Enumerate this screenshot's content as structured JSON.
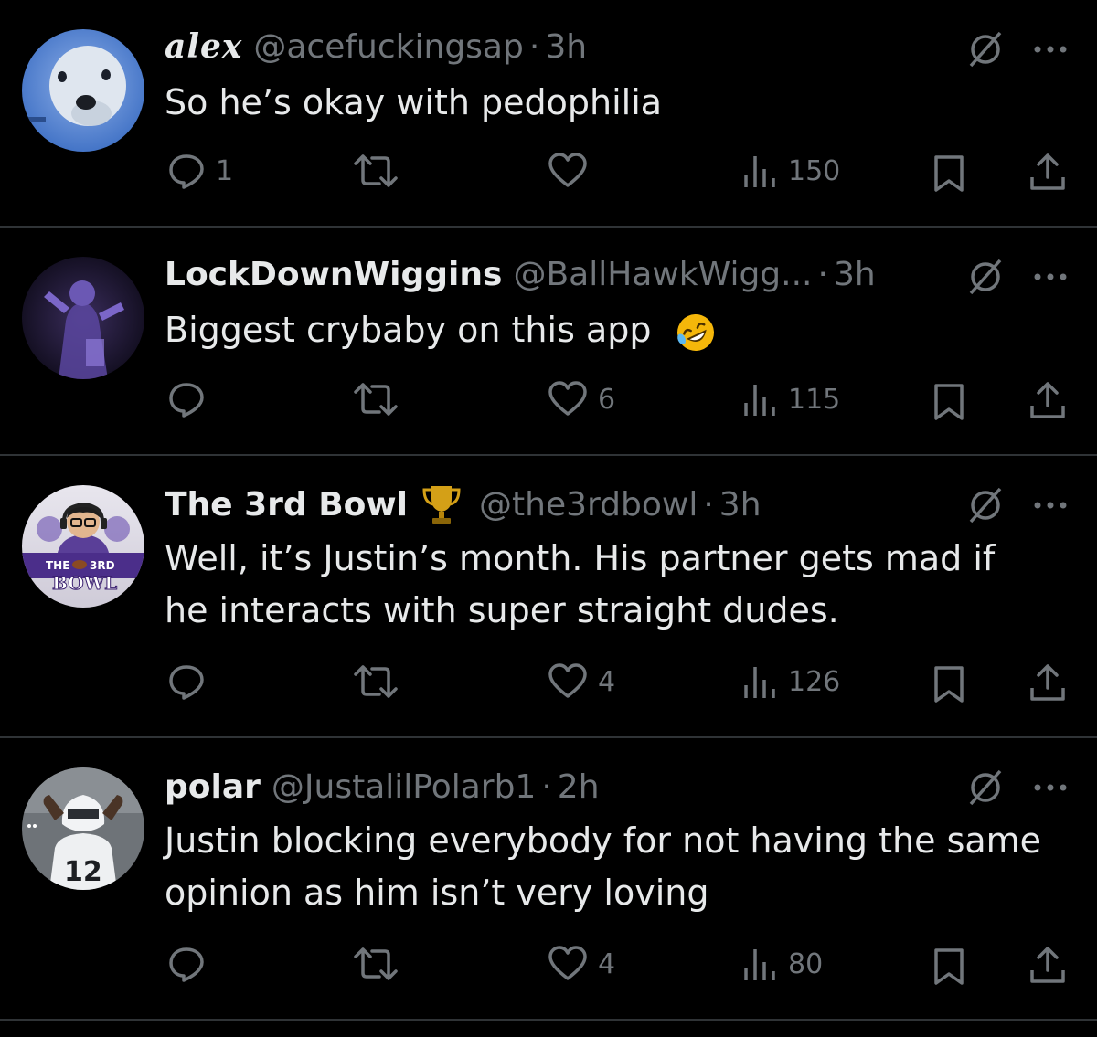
{
  "replies": [
    {
      "name": "alex",
      "handle": "@acefuckingsap",
      "separator": "·",
      "time": "3h",
      "text": "So he’s okay with pedophilia",
      "reply_count": "1",
      "retweet_count": "",
      "like_count": "",
      "view_count": "150"
    },
    {
      "name": "LockDownWiggins",
      "handle": "@BallHawkWigg...",
      "separator": "·",
      "time": "3h",
      "text": "Biggest crybaby on this app",
      "reply_count": "",
      "retweet_count": "",
      "like_count": "6",
      "view_count": "115"
    },
    {
      "name": "The 3rd Bowl",
      "handle": "@the3rdbowl",
      "separator": "·",
      "time": "3h",
      "text": "Well, it’s Justin’s month. His partner gets mad if he interacts with super straight dudes.",
      "reply_count": "",
      "retweet_count": "",
      "like_count": "4",
      "view_count": "126",
      "avatar_text_left": "THE",
      "avatar_text_right": "3RD",
      "avatar_text_bottom": "BOWL"
    },
    {
      "name": "polar",
      "handle": "@JustalilPolarb1",
      "separator": "·",
      "time": "2h",
      "text": "Justin blocking everybody for not having the same opinion as him isn’t very loving",
      "reply_count": "",
      "retweet_count": "",
      "like_count": "4",
      "view_count": "80",
      "avatar_jersey_number": "12"
    }
  ],
  "icons": {
    "reply": "reply-icon",
    "retweet": "retweet-icon",
    "like": "heart-icon",
    "views": "views-icon",
    "bookmark": "bookmark-icon",
    "share": "share-icon",
    "mute": "mute-icon",
    "more": "more-icon",
    "badge": "trophy-icon",
    "emoji": "rofl-emoji"
  },
  "colors": {
    "background": "#000000",
    "text_primary": "#e7e9ea",
    "text_secondary": "#71767b",
    "divider": "#2f3336",
    "trophy": "#d4a017",
    "emoji": "#f5b70a"
  }
}
